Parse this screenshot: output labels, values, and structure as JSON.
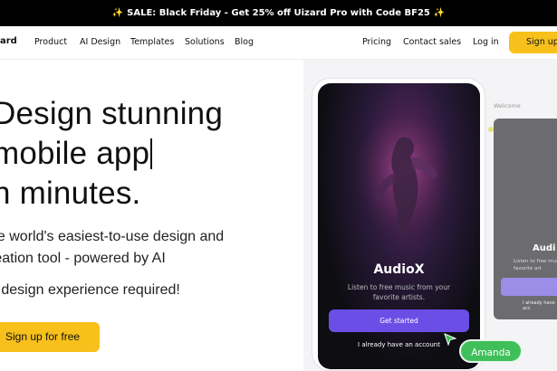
{
  "banner": {
    "text": "SALE: Black Friday - Get 25% off Uizard Pro with Code BF25"
  },
  "nav": {
    "logo": "ard",
    "items": [
      "Product",
      "AI Design",
      "Templates",
      "Solutions",
      "Blog"
    ],
    "right_items": [
      "Pricing",
      "Contact sales",
      "Log in"
    ],
    "cta": "Sign up"
  },
  "hero": {
    "title_lines": [
      "Design stunning",
      "mobile app",
      "n minutes."
    ],
    "subtitle_lines": [
      "he world's easiest-to-use design and",
      "reation tool - powered by AI"
    ],
    "note": "o design experience required!",
    "cta": "Sign up for free"
  },
  "mockup": {
    "app_name": "AudioX",
    "app_tagline_lines": [
      "Listen to free music from your",
      "favorite artists."
    ],
    "primary_button": "Get started",
    "secondary_link": "I already have an account",
    "collaborator": "Amanda",
    "side_label": "Welcome",
    "side_title": "Audi",
    "side_tagline": "Listen to free music favorite art",
    "side_link": "I already have acc",
    "accent_color": "#6b4ee6",
    "cursor_color": "#3fbf5a"
  }
}
